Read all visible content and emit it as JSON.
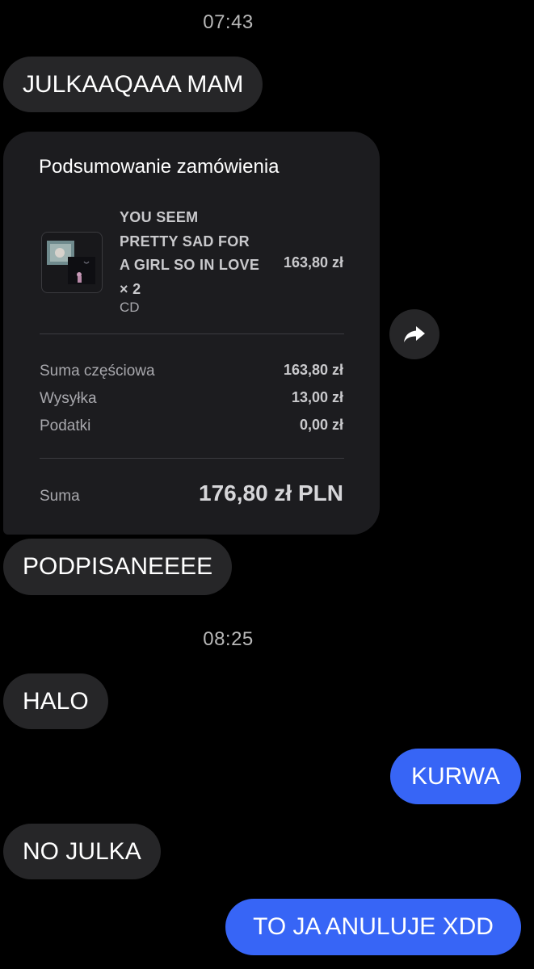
{
  "timestamps": [
    "07:43",
    "08:25"
  ],
  "messages": [
    {
      "direction": "incoming",
      "text": "JULKAAQAAA MAM"
    },
    {
      "direction": "incoming",
      "text": "PODPISANEEEE"
    },
    {
      "direction": "incoming",
      "text": "HALO"
    },
    {
      "direction": "outgoing",
      "text": "KURWA"
    },
    {
      "direction": "incoming",
      "text": "NO JULKA"
    },
    {
      "direction": "outgoing",
      "text": "TO JA ANULUJE XDD"
    }
  ],
  "order": {
    "title": "Podsumowanie zamówienia",
    "item": {
      "name": "YOU SEEM PRETTY SAD FOR A GIRL SO IN LOVE × 2",
      "type": "CD",
      "price": "163,80 zł",
      "thumbnail_icon": "album-cover-thumbnail"
    },
    "subtotal_label": "Suma częściowa",
    "subtotal_value": "163,80 zł",
    "shipping_label": "Wysyłka",
    "shipping_value": "13,00 zł",
    "tax_label": "Podatki",
    "tax_value": "0,00 zł",
    "total_label": "Suma",
    "total_value": "176,80 zł PLN"
  },
  "share_icon": "share-arrow-icon",
  "colors": {
    "background": "#000000",
    "incoming_bubble": "#262628",
    "outgoing_bubble": "#3765f6",
    "card": "#1c1c1f"
  }
}
